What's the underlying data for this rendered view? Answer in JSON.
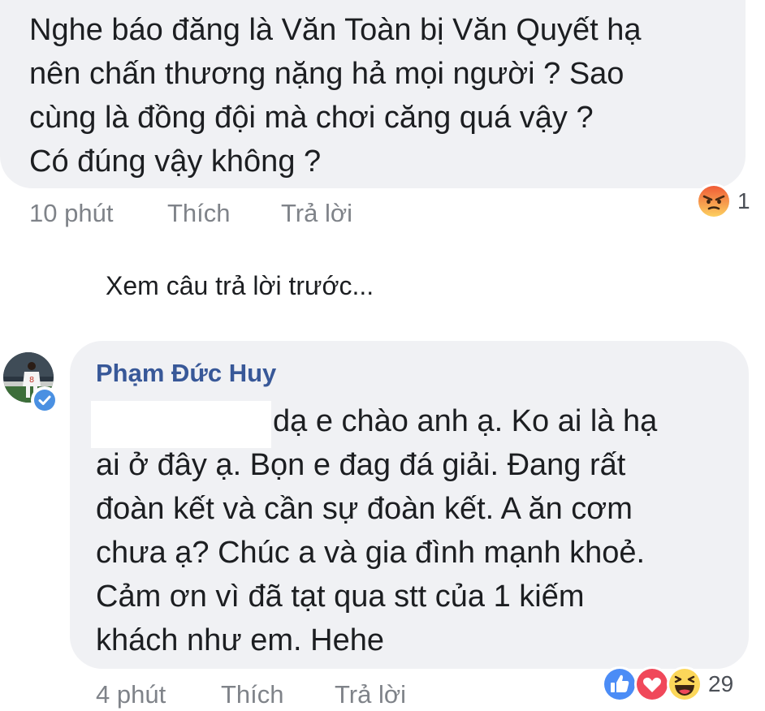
{
  "first_comment": {
    "lines": [
      "Nghe báo đăng là Văn Toàn bị Văn Quyết hạ",
      "nên chấn thương nặng hả mọi người ?  Sao",
      "cùng là đồng đội mà chơi căng quá vậy ?",
      "Có đúng vậy không ?"
    ],
    "time": "10 phút",
    "like_label": "Thích",
    "reply_label": "Trả lời",
    "reactions": {
      "icons": [
        "angry-icon"
      ],
      "count": "1"
    }
  },
  "view_previous_label": "Xem câu trả lời trước...",
  "reply_comment": {
    "author": "Phạm Đức Huy",
    "verified": true,
    "lines": [
      "dạ e chào anh ạ. Ko ai là hạ",
      "ai ở đây ạ. Bọn e đag đá giải. Đang rất",
      "đoàn kết và cần sự đoàn kết. A ăn cơm",
      "chưa ạ? Chúc a và gia đình mạnh khoẻ.",
      "Cảm ơn vì đã tạt qua stt của 1 kiếm",
      "khách như em. Hehe"
    ],
    "time": "4 phút",
    "like_label": "Thích",
    "reply_label": "Trả lời",
    "reactions": {
      "icons": [
        "like-icon",
        "love-icon",
        "haha-icon"
      ],
      "count": "29"
    }
  },
  "colors": {
    "bubble": "#f0f1f4",
    "author": "#385898",
    "meta": "#7f8389",
    "like_blue": "#1877f2",
    "love_red": "#f33e58",
    "emoji_yellow": "#fcd75a",
    "angry_orange": "#f08a4b"
  }
}
